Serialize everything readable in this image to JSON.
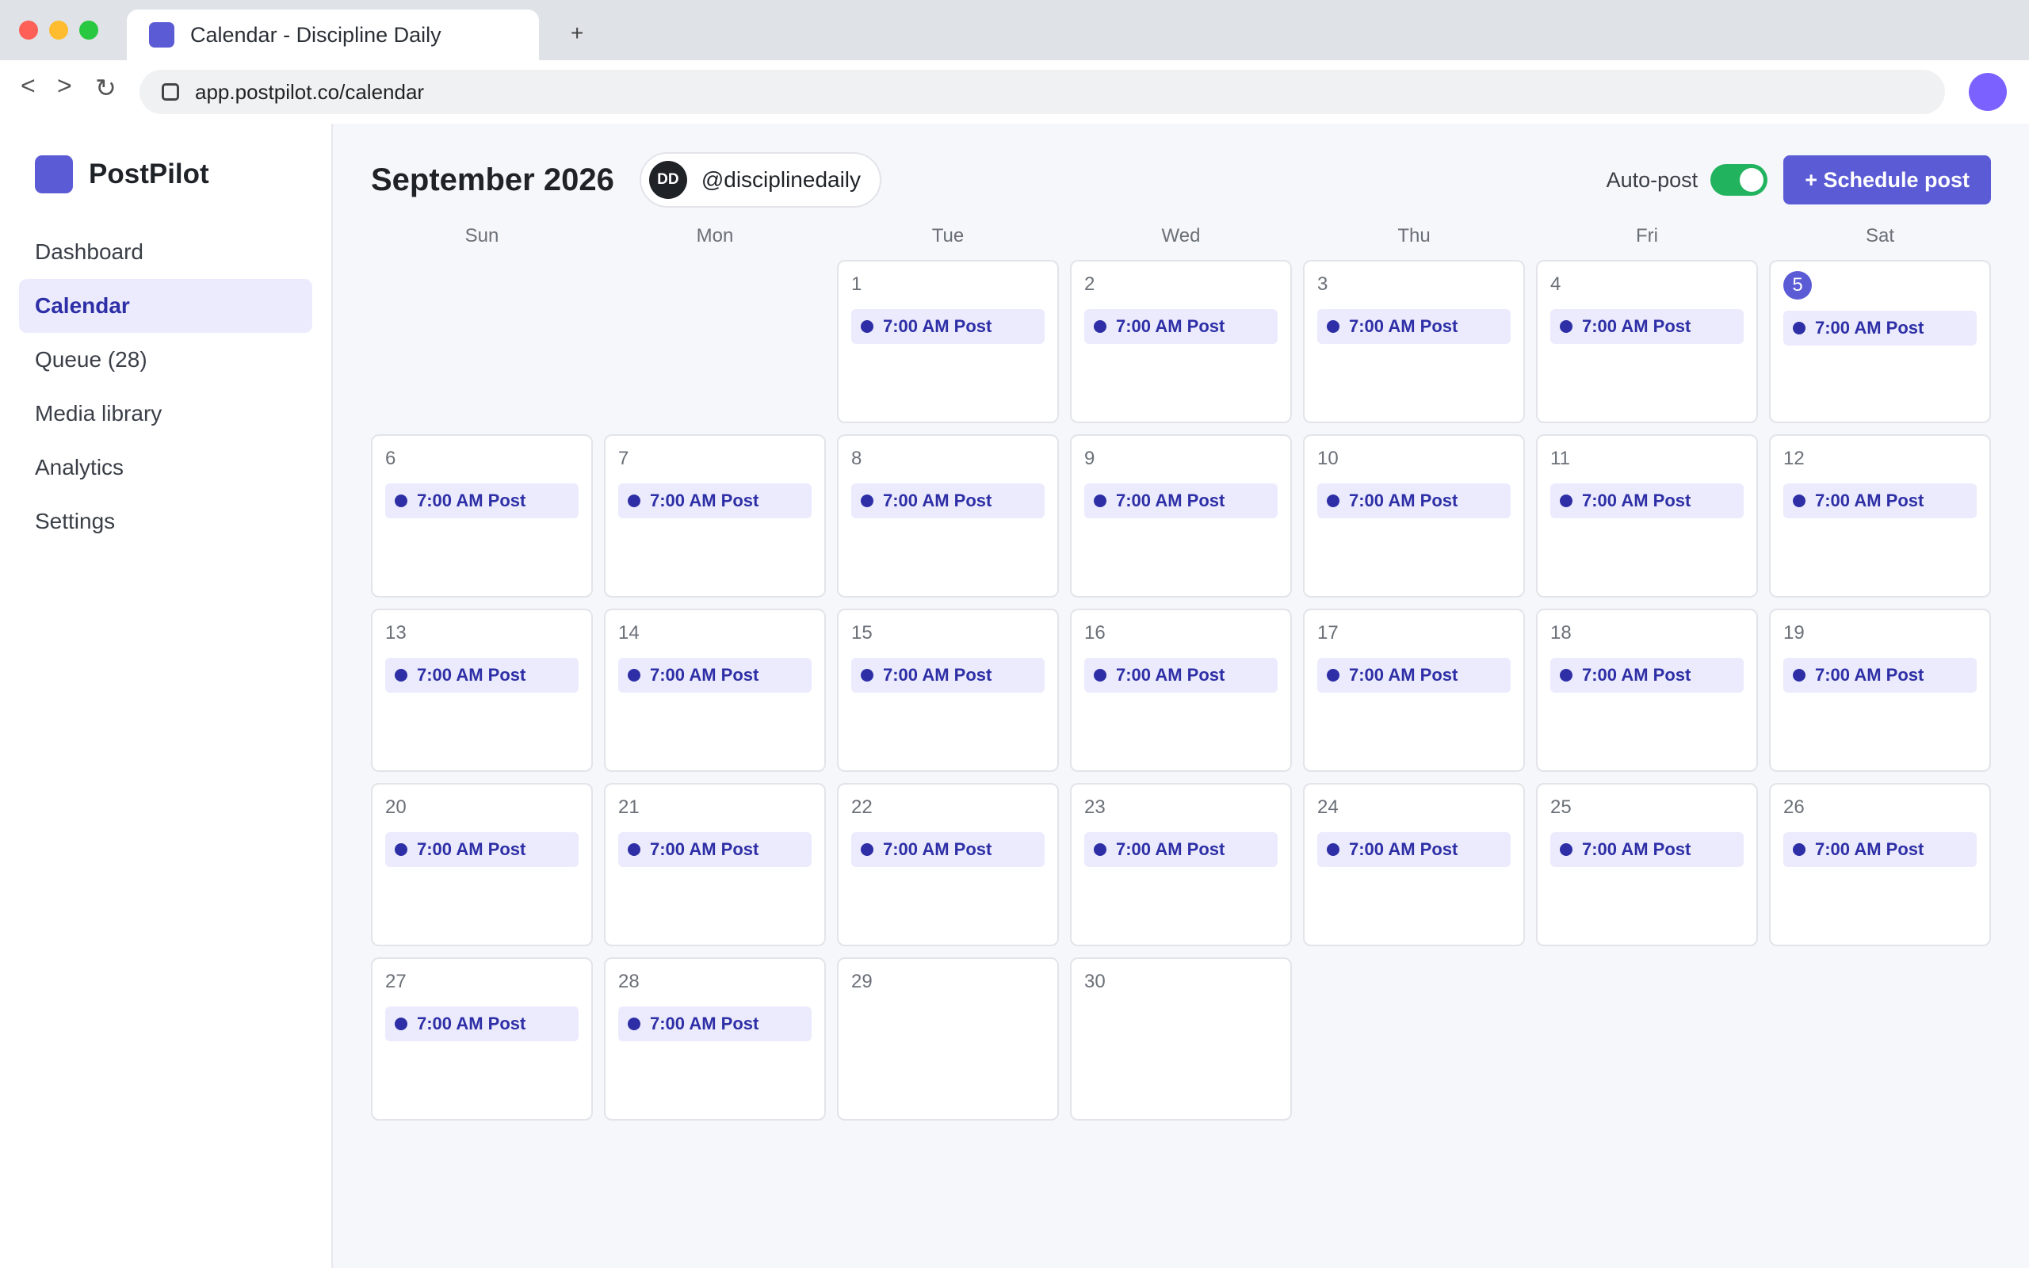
{
  "browser": {
    "tab_title": "Calendar - Discipline Daily",
    "new_tab": "+",
    "back": "<",
    "forward": ">",
    "reload": "↻",
    "url": "app.postpilot.co/calendar"
  },
  "sidebar": {
    "brand": "PostPilot",
    "items": [
      {
        "label": "Dashboard",
        "active": false
      },
      {
        "label": "Calendar",
        "active": true
      },
      {
        "label": "Queue (28)",
        "active": false
      },
      {
        "label": "Media library",
        "active": false
      },
      {
        "label": "Analytics",
        "active": false
      },
      {
        "label": "Settings",
        "active": false
      }
    ]
  },
  "header": {
    "month": "September 2026",
    "account_initials": "DD",
    "account_handle": "@disciplinedaily",
    "autopost_label": "Auto-post",
    "autopost_on": true,
    "schedule_label": "+ Schedule post"
  },
  "colors": {
    "accent": "#5b5bd6",
    "event_bg": "#ebebfd",
    "event_text": "#2e2fa6",
    "toggle_on": "#22b35e"
  },
  "calendar": {
    "weekdays": [
      "Sun",
      "Mon",
      "Tue",
      "Wed",
      "Thu",
      "Fri",
      "Sat"
    ],
    "leading_empty": 2,
    "today": 5,
    "event_label": "7:00 AM Post",
    "days": [
      {
        "day": "1",
        "events": [
          "7:00 AM Post"
        ]
      },
      {
        "day": "2",
        "events": [
          "7:00 AM Post"
        ]
      },
      {
        "day": "3",
        "events": [
          "7:00 AM Post"
        ]
      },
      {
        "day": "4",
        "events": [
          "7:00 AM Post"
        ]
      },
      {
        "day": "5",
        "events": [
          "7:00 AM Post"
        ]
      },
      {
        "day": "6",
        "events": [
          "7:00 AM Post"
        ]
      },
      {
        "day": "7",
        "events": [
          "7:00 AM Post"
        ]
      },
      {
        "day": "8",
        "events": [
          "7:00 AM Post"
        ]
      },
      {
        "day": "9",
        "events": [
          "7:00 AM Post"
        ]
      },
      {
        "day": "10",
        "events": [
          "7:00 AM Post"
        ]
      },
      {
        "day": "11",
        "events": [
          "7:00 AM Post"
        ]
      },
      {
        "day": "12",
        "events": [
          "7:00 AM Post"
        ]
      },
      {
        "day": "13",
        "events": [
          "7:00 AM Post"
        ]
      },
      {
        "day": "14",
        "events": [
          "7:00 AM Post"
        ]
      },
      {
        "day": "15",
        "events": [
          "7:00 AM Post"
        ]
      },
      {
        "day": "16",
        "events": [
          "7:00 AM Post"
        ]
      },
      {
        "day": "17",
        "events": [
          "7:00 AM Post"
        ]
      },
      {
        "day": "18",
        "events": [
          "7:00 AM Post"
        ]
      },
      {
        "day": "19",
        "events": [
          "7:00 AM Post"
        ]
      },
      {
        "day": "20",
        "events": [
          "7:00 AM Post"
        ]
      },
      {
        "day": "21",
        "events": [
          "7:00 AM Post"
        ]
      },
      {
        "day": "22",
        "events": [
          "7:00 AM Post"
        ]
      },
      {
        "day": "23",
        "events": [
          "7:00 AM Post"
        ]
      },
      {
        "day": "24",
        "events": [
          "7:00 AM Post"
        ]
      },
      {
        "day": "25",
        "events": [
          "7:00 AM Post"
        ]
      },
      {
        "day": "26",
        "events": [
          "7:00 AM Post"
        ]
      },
      {
        "day": "27",
        "events": [
          "7:00 AM Post"
        ]
      },
      {
        "day": "28",
        "events": [
          "7:00 AM Post"
        ]
      },
      {
        "day": "29",
        "events": []
      },
      {
        "day": "30",
        "events": []
      }
    ]
  }
}
